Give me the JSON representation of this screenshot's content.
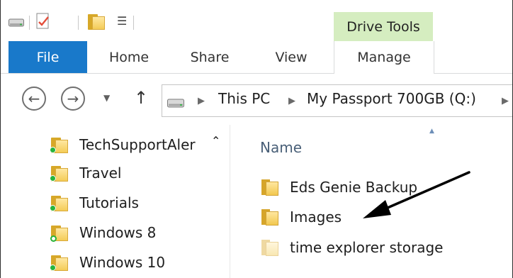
{
  "window": {
    "contextual_tab_group": "Drive Tools"
  },
  "quick_access": {
    "icons": [
      "drive-icon",
      "properties-icon",
      "new-folder-icon",
      "customize-dropdown-icon"
    ]
  },
  "ribbon": {
    "tabs": [
      {
        "label": "File",
        "active": true
      },
      {
        "label": "Home"
      },
      {
        "label": "Share"
      },
      {
        "label": "View"
      },
      {
        "label": "Manage"
      }
    ],
    "file_tab_color": "#1979ca",
    "contextual_color": "#d5edc0"
  },
  "address": {
    "segments": [
      "This PC",
      "My Passport 700GB (Q:)"
    ]
  },
  "navigation_pane": {
    "items": [
      {
        "label": "TechSupportAler",
        "overlay": "green-dot"
      },
      {
        "label": "Travel",
        "overlay": "green-dot"
      },
      {
        "label": "Tutorials",
        "overlay": "green-dot"
      },
      {
        "label": "Windows 8",
        "overlay": "sync-ring"
      },
      {
        "label": "Windows 10",
        "overlay": "green-dot"
      }
    ]
  },
  "content_pane": {
    "column_header": "Name",
    "items": [
      {
        "label": "Eds Genie Backup",
        "faint": false
      },
      {
        "label": "Images",
        "faint": false
      },
      {
        "label": "time explorer storage",
        "faint": true
      }
    ]
  }
}
